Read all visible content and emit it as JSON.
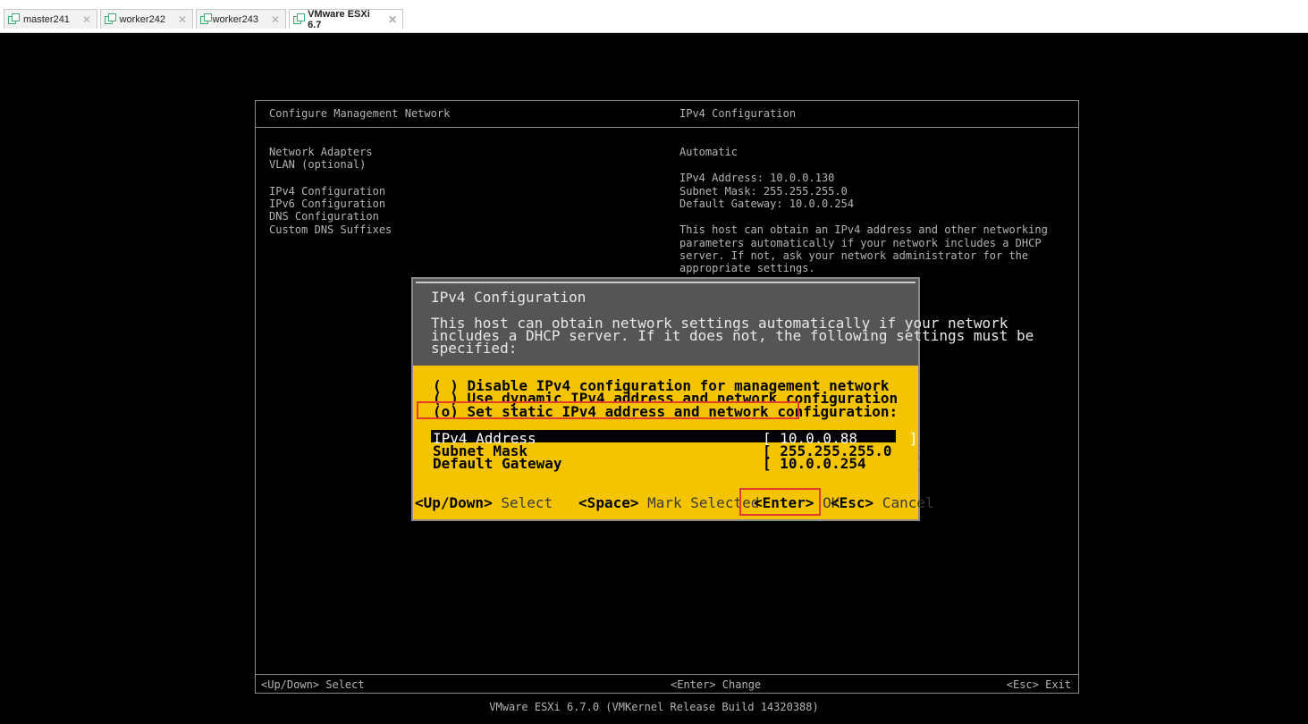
{
  "tabs": [
    {
      "label": "master241",
      "close": "✕"
    },
    {
      "label": "worker242",
      "close": "✕"
    },
    {
      "label": "worker243",
      "close": "✕"
    },
    {
      "label": "VMware ESXi 6.7",
      "close": "✕",
      "active": true
    }
  ],
  "console": {
    "left_title": "Configure Management Network",
    "right_title": "IPv4 Configuration",
    "menu": [
      "Network Adapters",
      "VLAN (optional)",
      "IPv4 Configuration",
      "IPv6 Configuration",
      "DNS Configuration",
      "Custom DNS Suffixes"
    ],
    "status": "Automatic",
    "ipv4_address": "IPv4 Address: 10.0.0.130",
    "subnet_mask": "Subnet Mask: 255.255.255.0",
    "default_gateway": "Default Gateway: 10.0.0.254",
    "description": [
      "This host can obtain an IPv4 address and other networking",
      "parameters automatically if your network includes a DHCP",
      "server. If not, ask your network administrator for the",
      "appropriate settings."
    ],
    "footer": {
      "left": "<Up/Down> Select",
      "center": "<Enter> Change",
      "right": "<Esc> Exit"
    },
    "build": "VMware ESXi 6.7.0 (VMKernel Release Build 14320388)"
  },
  "dialog": {
    "title": "IPv4 Configuration",
    "description": [
      "This host can obtain network settings automatically if your network",
      "includes a DHCP server. If it does not, the following settings must be",
      "specified:"
    ],
    "options": [
      "( ) Disable IPv4 configuration for management network",
      "( ) Use dynamic IPv4 address and network configuration",
      "(o) Set static IPv4 address and network configuration:"
    ],
    "fields": [
      {
        "label": "IPv4 Address",
        "value": "[ 10.0.0.88      ]"
      },
      {
        "label": "Subnet Mask",
        "value": "[ 255.255.255.0   ]"
      },
      {
        "label": "Default Gateway",
        "value": "[ 10.0.0.254      ]"
      }
    ],
    "hints": {
      "updown_key": "<Up/Down>",
      "updown_text": " Select",
      "space_key": "<Space>",
      "space_text": " Mark Selected",
      "enter_key": "<Enter>",
      "enter_text": " OK",
      "esc_key": "<Esc>",
      "esc_text": " Cancel"
    }
  },
  "colors": {
    "highlight": "#e53c2a",
    "dialog_bg": "#f5c400",
    "dialog_header": "#555555"
  }
}
